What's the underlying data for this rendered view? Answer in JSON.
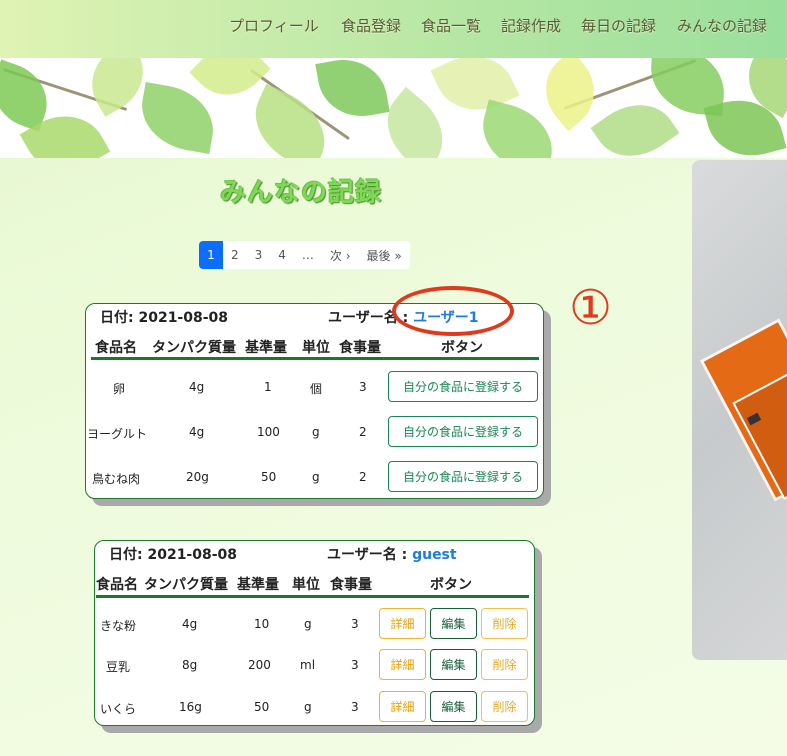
{
  "nav": {
    "items": [
      "プロフィール",
      "食品登録",
      "食品一覧",
      "記録作成",
      "毎日の記録",
      "みんなの記録"
    ]
  },
  "page_title": "みんなの記録",
  "pagination": {
    "pages": [
      "1",
      "2",
      "3",
      "4",
      "…",
      "次 ›",
      "最後 »"
    ],
    "active": "1"
  },
  "annotation": {
    "number": "①"
  },
  "headers": [
    "食品名",
    "タンパク質量",
    "基準量",
    "単位",
    "食事量",
    "ボタン"
  ],
  "records": [
    {
      "date_label": "日付: 2021-08-08",
      "user_label": "ユーザー名 : ",
      "user_name": "ユーザー1",
      "rows": [
        {
          "name": "卵",
          "protein": "4g",
          "base": "1",
          "unit": "個",
          "amount": "3"
        },
        {
          "name": "ヨーグルト",
          "protein": "4g",
          "base": "100",
          "unit": "g",
          "amount": "2"
        },
        {
          "name": "鳥むね肉",
          "protein": "20g",
          "base": "50",
          "unit": "g",
          "amount": "2"
        }
      ],
      "register_label": "自分の食品に登録する"
    },
    {
      "date_label": "日付: 2021-08-08",
      "user_label": "ユーザー名 : ",
      "user_name": "guest",
      "rows": [
        {
          "name": "きな粉",
          "protein": "4g",
          "base": "10",
          "unit": "g",
          "amount": "3"
        },
        {
          "name": "豆乳",
          "protein": "8g",
          "base": "200",
          "unit": "ml",
          "amount": "3"
        },
        {
          "name": "いくら",
          "protein": "16g",
          "base": "50",
          "unit": "g",
          "amount": "3"
        }
      ],
      "detail_label": "詳細",
      "edit_label": "編集",
      "delete_label": "削除"
    }
  ],
  "colors": {
    "accent_blue": "#0d6efd",
    "user_link": "#1e7be0",
    "success_green": "#198754",
    "warning_yellow": "#f0b429",
    "annotation_red": "#e0391c",
    "title_green": "#7ed957"
  }
}
